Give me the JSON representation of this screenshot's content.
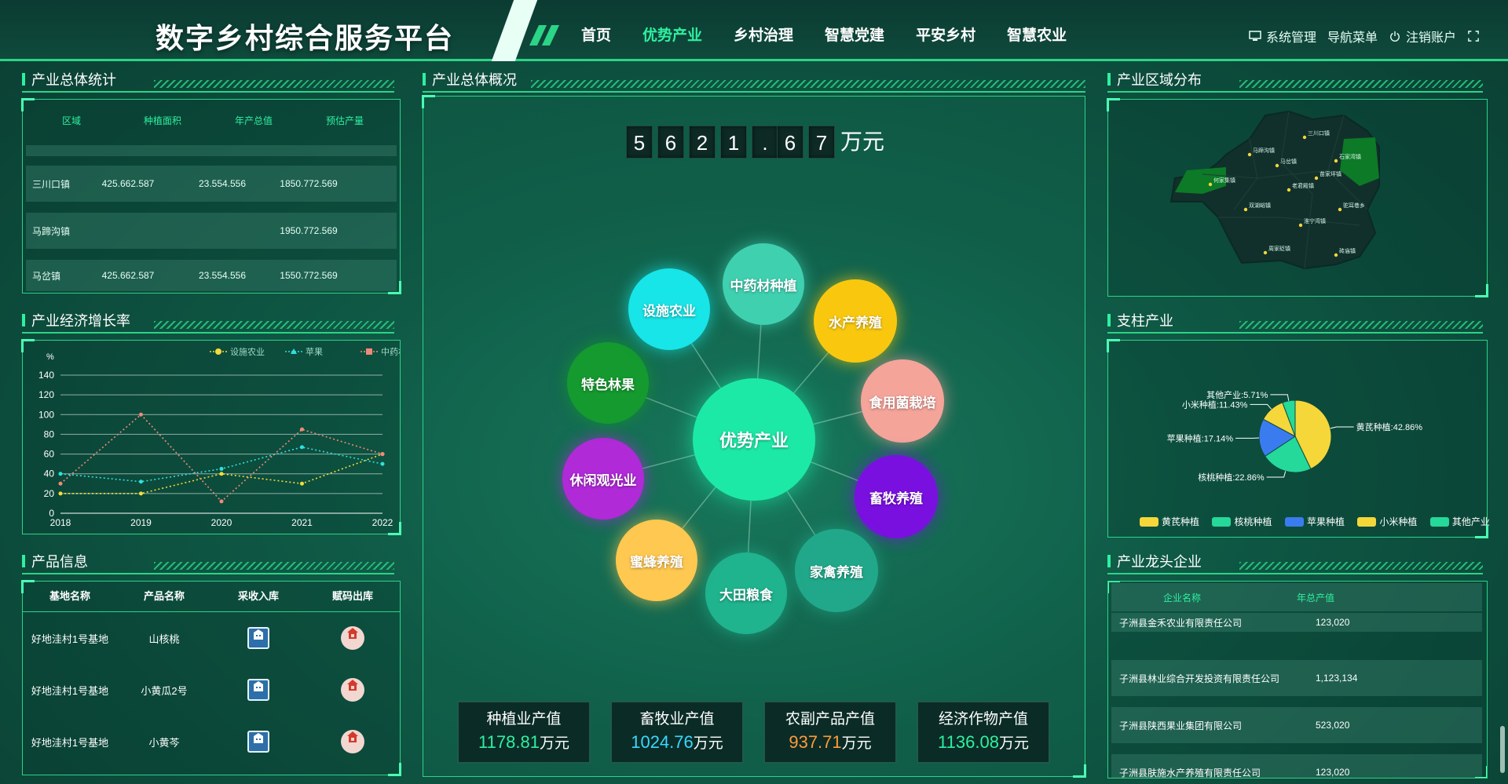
{
  "header": {
    "title": "数字乡村综合服务平台",
    "nav": [
      "首页",
      "优势产业",
      "乡村治理",
      "智慧党建",
      "平安乡村",
      "智慧农业"
    ],
    "active_index": 1,
    "right": {
      "system": "系统管理",
      "nav_menu": "导航菜单",
      "logout": "注销账户"
    }
  },
  "panels": {
    "stats_title": "产业总体统计",
    "growth_title": "产业经济增长率",
    "product_title": "产品信息",
    "overview_title": "产业总体概况",
    "region_title": "产业区域分布",
    "pillar_title": "支柱产业",
    "leader_title": "产业龙头企业"
  },
  "stats_table": {
    "headers": [
      "区域",
      "种植面积",
      "年产总值",
      "预估产量"
    ],
    "rows": [
      [
        "三川口镇",
        "425.662.587",
        "23.554.556",
        "1850.772.569"
      ],
      [
        "马蹄沟镇",
        "",
        "",
        "1950.772.569"
      ],
      [
        "马岔镇",
        "425.662.587",
        "23.554.556",
        "1550.772.569"
      ]
    ]
  },
  "chart_data": {
    "type": "line",
    "title": "",
    "ylabel": "%",
    "xlabel": "",
    "x": [
      "2018",
      "2019",
      "2020",
      "2021",
      "2022"
    ],
    "ylim": [
      0,
      140
    ],
    "yticks": [
      0,
      20,
      40,
      60,
      80,
      100,
      120,
      140
    ],
    "series": [
      {
        "name": "设施农业",
        "color": "#f5dc3a",
        "values": [
          20,
          20,
          40,
          30,
          60
        ]
      },
      {
        "name": "苹果",
        "color": "#2fe0e0",
        "values": [
          40,
          32,
          45,
          67,
          50
        ]
      },
      {
        "name": "中药材",
        "color": "#f08a7a",
        "values": [
          30,
          100,
          12,
          85,
          60
        ]
      }
    ]
  },
  "products": {
    "headers": [
      "基地名称",
      "产品名称",
      "采收入库",
      "赋码出库"
    ],
    "rows": [
      [
        "好地洼村1号基地",
        "山核桃"
      ],
      [
        "好地洼村1号基地",
        "小黄瓜2号"
      ],
      [
        "好地洼村1号基地",
        "小黄芩"
      ]
    ]
  },
  "overview": {
    "digits": [
      "5",
      "6",
      "2",
      "1",
      ".",
      "6",
      "7"
    ],
    "unit": "万元",
    "center_label": "优势产业",
    "bubbles": [
      {
        "label": "中药材种植",
        "color": "#3fd0b0"
      },
      {
        "label": "水产养殖",
        "color": "#f9c80e"
      },
      {
        "label": "食用菌栽培",
        "color": "#f5a49a"
      },
      {
        "label": "畜牧养殖",
        "color": "#7a10e0"
      },
      {
        "label": "家禽养殖",
        "color": "#21a88a"
      },
      {
        "label": "大田粮食",
        "color": "#1fb38e"
      },
      {
        "label": "蜜蜂养殖",
        "color": "#ffc850"
      },
      {
        "label": "休闲观光业",
        "color": "#b02ad8"
      },
      {
        "label": "特色林果",
        "color": "#149a2e"
      },
      {
        "label": "设施农业",
        "color": "#17e5e8"
      }
    ],
    "cards": [
      {
        "label": "种植业产值",
        "value": "1178.81",
        "unit": "万元",
        "color": "#2ef0a0"
      },
      {
        "label": "畜牧业产值",
        "value": "1024.76",
        "unit": "万元",
        "color": "#3ad8ff"
      },
      {
        "label": "农副产品产值",
        "value": "937.71",
        "unit": "万元",
        "color": "#ff9a3a"
      },
      {
        "label": "经济作物产值",
        "value": "1136.08",
        "unit": "万元",
        "color": "#2ef0a0"
      }
    ]
  },
  "map": {
    "labels": [
      "三川口镇",
      "马蹄沟镇",
      "马岔镇",
      "石家湾镇",
      "何家集镇",
      "苗家坪镇",
      "老君殿镇",
      "双湖峪镇",
      "驼耳巷乡",
      "淮宁湾镇",
      "周家砭镇",
      "砖庙镇"
    ]
  },
  "pie": {
    "slices": [
      {
        "name": "黄芪种植",
        "label": "黄芪种植:42.86%",
        "value": 42.86,
        "color": "#f5d73a"
      },
      {
        "name": "核桃种植",
        "label": "核桃种植:22.86%",
        "value": 22.86,
        "color": "#25d99a"
      },
      {
        "name": "苹果种植",
        "label": "苹果种植:17.14%",
        "value": 17.14,
        "color": "#3a7cf0"
      },
      {
        "name": "小米种植",
        "label": "小米种植:11.43%",
        "value": 11.43,
        "color": "#f5d73a"
      },
      {
        "name": "其他产业",
        "label": "其他产业:5.71%",
        "value": 5.71,
        "color": "#25d99a"
      }
    ]
  },
  "enterprises": {
    "headers": [
      "企业名称",
      "年总产值"
    ],
    "rows": [
      [
        "子洲县金禾农业有限责任公司",
        "123,020"
      ],
      [
        "子洲县林业综合开发投资有限责任公司",
        "1,123,134"
      ],
      [
        "子洲县陕西果业集团有限公司",
        "523,020"
      ],
      [
        "子洲县肤施水产养殖有限责任公司",
        "123,020"
      ]
    ]
  }
}
